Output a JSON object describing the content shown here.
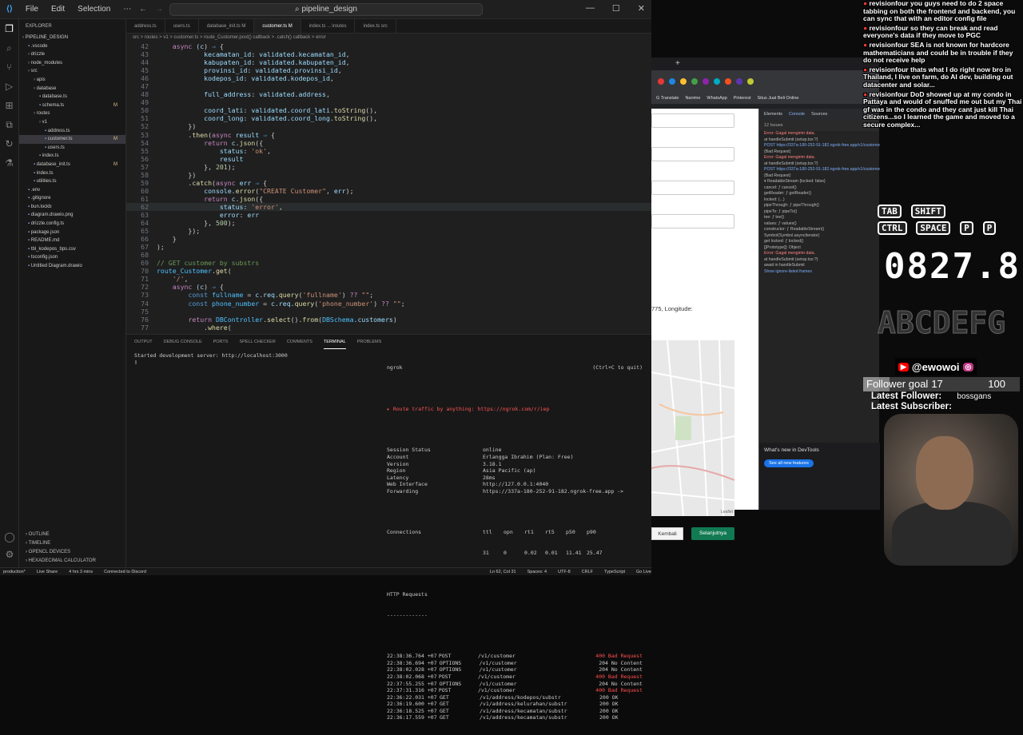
{
  "titlebar": {
    "menus": [
      "File",
      "Edit",
      "Selection",
      "⋯"
    ],
    "search": "pipeline_design"
  },
  "explorer": {
    "header": "EXPLORER",
    "items": [
      {
        "label": "PIPELINE_DESIGN",
        "indent": 0,
        "mark": ""
      },
      {
        "label": ".vscode",
        "indent": 1,
        "mark": ""
      },
      {
        "label": "drizzle",
        "indent": 1,
        "mark": ""
      },
      {
        "label": "node_modules",
        "indent": 1,
        "mark": ""
      },
      {
        "label": "src",
        "indent": 1,
        "mark": ""
      },
      {
        "label": "apis",
        "indent": 2,
        "mark": ""
      },
      {
        "label": "database",
        "indent": 2,
        "mark": ""
      },
      {
        "label": "database.ts",
        "indent": 3,
        "mark": ""
      },
      {
        "label": "schema.ts",
        "indent": 3,
        "mark": "M"
      },
      {
        "label": "routes",
        "indent": 2,
        "mark": ""
      },
      {
        "label": "v1",
        "indent": 3,
        "mark": ""
      },
      {
        "label": "address.ts",
        "indent": 4,
        "mark": ""
      },
      {
        "label": "customer.ts",
        "indent": 4,
        "mark": "M",
        "selected": true
      },
      {
        "label": "users.ts",
        "indent": 4,
        "mark": ""
      },
      {
        "label": "index.ts",
        "indent": 3,
        "mark": ""
      },
      {
        "label": "database_init.ts",
        "indent": 2,
        "mark": "M"
      },
      {
        "label": "index.ts",
        "indent": 2,
        "mark": ""
      },
      {
        "label": "utilities.ts",
        "indent": 2,
        "mark": ""
      },
      {
        "label": ".env",
        "indent": 1,
        "mark": ""
      },
      {
        "label": ".gitignore",
        "indent": 1,
        "mark": ""
      },
      {
        "label": "bun.lockb",
        "indent": 1,
        "mark": ""
      },
      {
        "label": "diagram.drawio.png",
        "indent": 1,
        "mark": ""
      },
      {
        "label": "drizzle.config.ts",
        "indent": 1,
        "mark": ""
      },
      {
        "label": "package.json",
        "indent": 1,
        "mark": ""
      },
      {
        "label": "README.md",
        "indent": 1,
        "mark": ""
      },
      {
        "label": "tbl_kodepos_bps.csv",
        "indent": 1,
        "mark": ""
      },
      {
        "label": "tsconfig.json",
        "indent": 1,
        "mark": ""
      },
      {
        "label": "Untitled Diagram.drawio",
        "indent": 1,
        "mark": ""
      }
    ],
    "bottom_sections": [
      "OUTLINE",
      "TIMELINE",
      "OPENCL DEVICES",
      "HEXADECIMAL CALCULATOR"
    ]
  },
  "tabs": [
    {
      "label": "address.ts",
      "active": false
    },
    {
      "label": "users.ts",
      "active": false
    },
    {
      "label": "database_init.ts M",
      "active": false
    },
    {
      "label": "customer.ts M",
      "active": true
    },
    {
      "label": "index.ts …\\routes",
      "active": false
    },
    {
      "label": "index.ts src",
      "active": false
    }
  ],
  "breadcrumb": "src > routes > v1 > customer.ts > route_Customer.post() callback > .catch() callback > error",
  "code_lines": [
    {
      "n": "42",
      "html": "    <span class='k'>async</span> (<span class='v'>c</span>) <span class='t'>⇒</span> {"
    },
    {
      "n": "43",
      "html": "            <span class='v'>kecamatan_id</span>: <span class='v'>validated</span>.<span class='v'>kecamatan_id</span>,"
    },
    {
      "n": "44",
      "html": "            <span class='v'>kabupaten_id</span>: <span class='v'>validated</span>.<span class='v'>kabupaten_id</span>,"
    },
    {
      "n": "45",
      "html": "            <span class='v'>provinsi_id</span>: <span class='v'>validated</span>.<span class='v'>provinsi_id</span>,"
    },
    {
      "n": "46",
      "html": "            <span class='v'>kodepos_id</span>: <span class='v'>validated</span>.<span class='v'>kodepos_id</span>,"
    },
    {
      "n": "47",
      "html": ""
    },
    {
      "n": "48",
      "html": "            <span class='v'>full_address</span>: <span class='v'>validated</span>.<span class='v'>address</span>,"
    },
    {
      "n": "49",
      "html": ""
    },
    {
      "n": "50",
      "html": "            <span class='v'>coord_lati</span>: <span class='v'>validated</span>.<span class='v'>coord_lati</span>.<span class='f'>toString</span>(),"
    },
    {
      "n": "51",
      "html": "            <span class='v'>coord_long</span>: <span class='v'>validated</span>.<span class='v'>coord_long</span>.<span class='f'>toString</span>(),"
    },
    {
      "n": "52",
      "html": "        })"
    },
    {
      "n": "53",
      "html": "        .<span class='f'>then</span>(<span class='k'>async</span> <span class='v'>result</span> <span class='t'>⇒</span> {"
    },
    {
      "n": "54",
      "html": "            <span class='k'>return</span> <span class='v'>c</span>.<span class='f'>json</span>({"
    },
    {
      "n": "55",
      "html": "                <span class='v'>status</span>: <span class='s'>'ok'</span>,"
    },
    {
      "n": "56",
      "html": "                <span class='v'>result</span>"
    },
    {
      "n": "57",
      "html": "            }, <span class='n'>201</span>);"
    },
    {
      "n": "58",
      "html": "        })"
    },
    {
      "n": "59",
      "html": "        .<span class='f'>catch</span>(<span class='k'>async</span> <span class='v'>err</span> <span class='t'>⇒</span> {"
    },
    {
      "n": "60",
      "html": "            <span class='v'>console</span>.<span class='f'>error</span>(<span class='s'>\"CREATE Customer\"</span>, <span class='v'>err</span>);"
    },
    {
      "n": "61",
      "html": "            <span class='k'>return</span> <span class='v'>c</span>.<span class='f'>json</span>({"
    },
    {
      "n": "62",
      "html": "                <span class='v'>status</span>: <span class='s'>'error'</span>,"
    },
    {
      "n": "63",
      "html": "                <span class='v'>error</span>: <span class='v'>err</span>"
    },
    {
      "n": "64",
      "html": "            }, <span class='n'>500</span>);"
    },
    {
      "n": "65",
      "html": "        });"
    },
    {
      "n": "66",
      "html": "    }"
    },
    {
      "n": "67",
      "html": ");"
    },
    {
      "n": "68",
      "html": ""
    },
    {
      "n": "69",
      "html": "<span class='c'>// GET customer by substrs</span>"
    },
    {
      "n": "70",
      "html": "<span class='b'>route_Customer</span>.<span class='f'>get</span>("
    },
    {
      "n": "71",
      "html": "    <span class='s'>'/'</span>,"
    },
    {
      "n": "72",
      "html": "    <span class='k'>async</span> (<span class='v'>c</span>) <span class='t'>⇒</span> {"
    },
    {
      "n": "73",
      "html": "        <span class='t'>const</span> <span class='b'>fullname</span> = <span class='v'>c</span>.<span class='v'>req</span>.<span class='f'>query</span>(<span class='s'>'fullname'</span>) <span class='k'>??</span> <span class='s'>\"\"</span>;"
    },
    {
      "n": "74",
      "html": "        <span class='t'>const</span> <span class='b'>phone_number</span> = <span class='v'>c</span>.<span class='v'>req</span>.<span class='f'>query</span>(<span class='s'>'phone_number'</span>) <span class='k'>??</span> <span class='s'>\"\"</span>;"
    },
    {
      "n": "75",
      "html": ""
    },
    {
      "n": "76",
      "html": "        <span class='k'>return</span> <span class='b'>DBController</span>.<span class='f'>select</span>().<span class='f'>from</span>(<span class='b'>DBSchema</span>.<span class='v'>customers</span>)"
    },
    {
      "n": "77",
      "html": "            .<span class='f'>where</span>("
    }
  ],
  "panel": {
    "tabs": [
      "OUTPUT",
      "DEBUG CONSOLE",
      "PORTS",
      "SPELL CHECKER",
      "COMMENTS",
      "TERMINAL",
      "PROBLEMS"
    ],
    "active_tab": "TERMINAL",
    "server_line": "Started development server: http://localhost:3000",
    "ngrok": {
      "title": "ngrok",
      "quit_hint": "(Ctrl+C to quit)",
      "promo": "Route traffic by anything: https://ngrok.com/r/iep",
      "fields": [
        {
          "k": "Session Status",
          "v": "online"
        },
        {
          "k": "Account",
          "v": "Erlangga Ibrahim (Plan: Free)"
        },
        {
          "k": "Version",
          "v": "3.18.1"
        },
        {
          "k": "Region",
          "v": "Asia Pacific (ap)"
        },
        {
          "k": "Latency",
          "v": "28ms"
        },
        {
          "k": "Web Interface",
          "v": "http://127.0.0.1:4040"
        },
        {
          "k": "Forwarding",
          "v": "https://337a-180-252-91-182.ngrok-free.app ->"
        }
      ],
      "connections_label": "Connections",
      "conn_headers": [
        "ttl",
        "opn",
        "rt1",
        "rt5",
        "p50",
        "p90"
      ],
      "conn_values": [
        "31",
        "0",
        "0.02",
        "0.01",
        "11.41",
        "25.47"
      ],
      "requests_title": "HTTP Requests",
      "requests_rule": "-------------",
      "requests": [
        {
          "time": "22:38:36.764 +07",
          "method": "POST",
          "path": "/v1/customer",
          "status": "400 Bad Request",
          "bad": true
        },
        {
          "time": "22:38:36.694 +07",
          "method": "OPTIONS",
          "path": "/v1/customer",
          "status": "204 No Content",
          "bad": false
        },
        {
          "time": "22:38:02.028 +07",
          "method": "OPTIONS",
          "path": "/v1/customer",
          "status": "204 No Content",
          "bad": false
        },
        {
          "time": "22:38:02.068 +07",
          "method": "POST",
          "path": "/v1/customer",
          "status": "400 Bad Request",
          "bad": true
        },
        {
          "time": "22:37:55.255 +07",
          "method": "OPTIONS",
          "path": "/v1/customer",
          "status": "204 No Content",
          "bad": false
        },
        {
          "time": "22:37:31.316 +07",
          "method": "POST",
          "path": "/v1/customer",
          "status": "400 Bad Request",
          "bad": true
        },
        {
          "time": "22:36:22.031 +07",
          "method": "GET",
          "path": "/v1/address/kodepos/substr",
          "status": "200 OK",
          "bad": false
        },
        {
          "time": "22:36:19.600 +07",
          "method": "GET",
          "path": "/v1/address/kelurahan/substr",
          "status": "200 OK",
          "bad": false
        },
        {
          "time": "22:36:18.525 +07",
          "method": "GET",
          "path": "/v1/address/kecamatan/substr",
          "status": "200 OK",
          "bad": false
        },
        {
          "time": "22:36:17.559 +07",
          "method": "GET",
          "path": "/v1/address/kecamatan/substr",
          "status": "200 OK",
          "bad": false
        }
      ]
    }
  },
  "statusbar": {
    "items": [
      "production*",
      "Live Share",
      "4 hrs 3 mins",
      "Connected to Discord",
      "Ln 62, Col 31",
      "Spaces: 4",
      "UTF-8",
      "CRLF",
      "TypeScript",
      "Go Live"
    ]
  },
  "browser": {
    "bookmarks": [
      "G Translate",
      "Nanime",
      "WhatsApp",
      "Pinterest",
      "Situs Jual Beli Online"
    ],
    "page_text": "775, Longitude:",
    "map_credit": "Leaflet",
    "back_button": "Kembali",
    "next_button": "Selanjutnya",
    "devtools_tabs": [
      "Elements",
      "Console",
      "Sources"
    ],
    "issues": "12 Issues",
    "console_lines": [
      {
        "t": "Error: Gagal mengirim data.",
        "c": "ce"
      },
      {
        "t": "at handleSubmit (setup.tsx:?)",
        "c": "cg"
      },
      {
        "t": "POST https://337a-180-252-91-182.ngrok-free.app/v1/customer",
        "c": "cu"
      },
      {
        "t": "(Bad Request)",
        "c": "cg"
      },
      {
        "t": "Error: Gagal mengirim data.",
        "c": "ce"
      },
      {
        "t": "at handleSubmit (setup.tsx:?)",
        "c": "cg"
      },
      {
        "t": "POST https://337a-180-252-91-182.ngrok-free.app/v1/customer",
        "c": "cu"
      },
      {
        "t": "(Bad Request)",
        "c": "cg"
      },
      {
        "t": "▾ ReadableStream {locked: false}",
        "c": "cg"
      },
      {
        "t": "  cancel: ƒ cancel()",
        "c": "cg"
      },
      {
        "t": "  getReader: ƒ getReader()",
        "c": "cg"
      },
      {
        "t": "  locked: (...)",
        "c": "cg"
      },
      {
        "t": "  pipeThrough: ƒ pipeThrough()",
        "c": "cg"
      },
      {
        "t": "  pipeTo: ƒ pipeTo()",
        "c": "cg"
      },
      {
        "t": "  tee: ƒ tee()",
        "c": "cg"
      },
      {
        "t": "  values: ƒ values()",
        "c": "cg"
      },
      {
        "t": "  constructor: ƒ ReadableStream()",
        "c": "cg"
      },
      {
        "t": "  Symbol(Symbol.asyncIterator)",
        "c": "cg"
      },
      {
        "t": "  get locked: ƒ locked()",
        "c": "cg"
      },
      {
        "t": "  [[Prototype]]: Object",
        "c": "cg"
      },
      {
        "t": "Error: Gagal mengirim data.",
        "c": "ce"
      },
      {
        "t": "at handleSubmit (setup.tsx:?)",
        "c": "cg"
      },
      {
        "t": "await in handleSubmit",
        "c": "cg"
      },
      {
        "t": "Show ignore-listed frames",
        "c": "cu"
      }
    ],
    "whatsnew_title": "What's new in DevTools",
    "whatsnew_link": "See all new features"
  },
  "stream": {
    "chat": [
      {
        "user": "revisionfour",
        "msg": "you guys need to do 2 space tabbing on both the frontend and backend, you can sync that with an editor config file"
      },
      {
        "user": "revisionfour",
        "msg": "so they can break and read everyone's data if they move to PGC"
      },
      {
        "user": "revisionfour",
        "msg": "SEA is not known for hardcore mathematicians and could be in trouble if they do not receive help"
      },
      {
        "user": "revisionfour",
        "msg": "thats what I do right now bro in Thailand, I live on farm, do AI dev, building out datacenter and solar..."
      },
      {
        "user": "revisionfour",
        "msg": "DoD showed up at my condo in Pattaya and would of snuffed me out but my Thai gf was in the condo and they cant just kill Thai citizens...so I learned the game and moved to a secure complex..."
      }
    ],
    "keys": [
      "TAB",
      "SHIFT",
      "CTRL",
      "SPACE",
      "P",
      "P"
    ],
    "clock": "0827.8",
    "alphabet": "ABCDEFG",
    "handle": "@ewowoi",
    "follower_goal_label": "Follower goal",
    "follower_count": "17",
    "follower_target": "100",
    "follower_fraction": 0.17,
    "latest_follower_label": "Latest Follower:",
    "latest_follower": "bossgans",
    "latest_subscriber_label": "Latest Subscriber:",
    "latest_subscriber": ""
  }
}
